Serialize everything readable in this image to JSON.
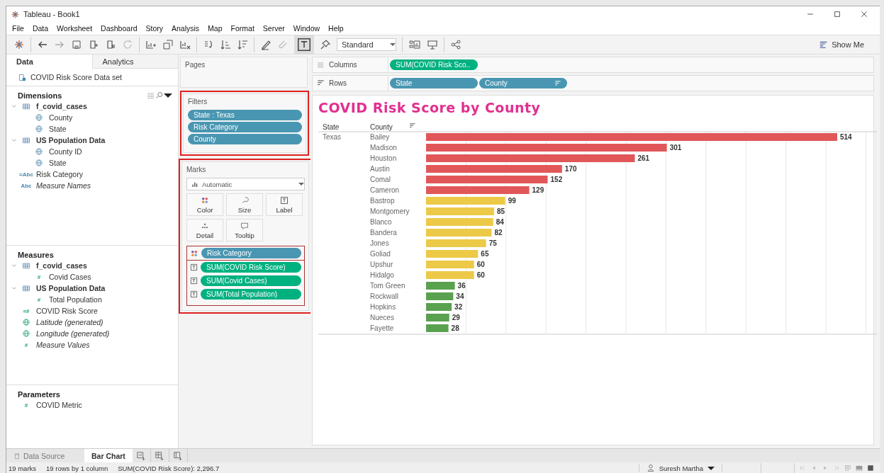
{
  "window": {
    "title": "Tableau - Book1"
  },
  "menu": [
    "File",
    "Data",
    "Worksheet",
    "Dashboard",
    "Story",
    "Analysis",
    "Map",
    "Format",
    "Server",
    "Window",
    "Help"
  ],
  "toolbar": {
    "fit_dropdown": "Standard",
    "show_me": "Show Me"
  },
  "data_pane": {
    "tabs": [
      {
        "label": "Data",
        "selected": true
      },
      {
        "label": "Analytics",
        "selected": false
      }
    ],
    "data_source": "COVID Risk Score Data set",
    "sections": [
      {
        "title": "Dimensions",
        "kind": "dimension",
        "items": [
          {
            "label": "f_covid_cases",
            "kind": "table",
            "expanded": true,
            "children": [
              {
                "label": "County",
                "kind": "geo",
                "generated": false
              },
              {
                "label": "State",
                "kind": "geo",
                "generated": false
              }
            ]
          },
          {
            "label": "US Population Data",
            "kind": "table",
            "expanded": true,
            "children": [
              {
                "label": "County ID",
                "kind": "geo",
                "generated": false
              },
              {
                "label": "State",
                "kind": "geo",
                "generated": false
              }
            ]
          },
          {
            "label": "Risk Category",
            "kind": "type",
            "icon": "=Abc",
            "generated": false
          },
          {
            "label": "Measure Names",
            "kind": "type",
            "icon": "Abc",
            "generated": true
          }
        ]
      },
      {
        "title": "Measures",
        "kind": "measure",
        "items": [
          {
            "label": "f_covid_cases",
            "kind": "table",
            "expanded": true,
            "children": [
              {
                "label": "Covid Cases",
                "kind": "type",
                "icon": "#",
                "generated": false
              }
            ]
          },
          {
            "label": "US Population Data",
            "kind": "table",
            "expanded": true,
            "children": [
              {
                "label": "Total Population",
                "kind": "type",
                "icon": "#",
                "generated": false
              }
            ]
          },
          {
            "label": "COVID Risk Score",
            "kind": "type",
            "icon": "=#",
            "generated": false
          },
          {
            "label": "Latitude (generated)",
            "kind": "geo",
            "generated": true
          },
          {
            "label": "Longitude (generated)",
            "kind": "geo",
            "generated": true
          },
          {
            "label": "Measure Values",
            "kind": "type",
            "icon": "#",
            "generated": true
          }
        ]
      },
      {
        "title": "Parameters",
        "kind": "measure",
        "items": [
          {
            "label": "COVID Metric",
            "kind": "type",
            "icon": "#",
            "generated": false
          }
        ]
      }
    ]
  },
  "pages": {
    "title": "Pages"
  },
  "filters": {
    "title": "Filters",
    "pills": [
      {
        "label": "State : Texas",
        "kind": "dimension"
      },
      {
        "label": "Risk Category",
        "kind": "dimension"
      },
      {
        "label": "County",
        "kind": "dimension"
      }
    ]
  },
  "marks": {
    "title": "Marks",
    "mark_type": "Automatic",
    "buttons": [
      {
        "label": "Color",
        "kind": "color"
      },
      {
        "label": "Size",
        "kind": "size"
      },
      {
        "label": "Label",
        "kind": "label"
      },
      {
        "label": "Detail",
        "kind": "detail"
      },
      {
        "label": "Tooltip",
        "kind": "tooltip"
      }
    ],
    "encodings": [
      {
        "kind": "color",
        "pill": {
          "label": "Risk Category",
          "kind": "dimension"
        }
      },
      {
        "kind": "label",
        "pill": {
          "label": "SUM(COVID Risk Score)",
          "kind": "measure"
        }
      },
      {
        "kind": "label",
        "pill": {
          "label": "SUM(Covid Cases)",
          "kind": "measure"
        }
      },
      {
        "kind": "label",
        "pill": {
          "label": "SUM(Total Population)",
          "kind": "measure"
        }
      }
    ]
  },
  "shelves": [
    {
      "label": "Columns",
      "kind": "columns",
      "pills": [
        {
          "label": "SUM(COVID Risk Sco..",
          "kind": "measure",
          "sorted": false
        }
      ]
    },
    {
      "label": "Rows",
      "kind": "rows",
      "pills": [
        {
          "label": "State",
          "kind": "dimension",
          "sorted": false
        },
        {
          "label": "County",
          "kind": "dimension",
          "sorted": true
        }
      ]
    }
  ],
  "view": {
    "state_header": "State",
    "state_value": "Texas",
    "chart_data": {
      "type": "bar",
      "orientation": "horizontal",
      "title": "COVID Risk Score by County",
      "ylabel": "County",
      "data_labels": true,
      "categories": [
        "Bailey",
        "Madison",
        "Houston",
        "Austin",
        "Comal",
        "Cameron",
        "Bastrop",
        "Montgomery",
        "Blanco",
        "Bandera",
        "Jones",
        "Goliad",
        "Upshur",
        "Hidalgo",
        "Tom Green",
        "Rockwall",
        "Hopkins",
        "Nueces",
        "Fayette"
      ],
      "series": [
        {
          "color": "#e15759",
          "values": [
            514,
            301,
            261,
            170,
            152,
            129,
            null,
            null,
            null,
            null,
            null,
            null,
            null,
            null,
            null,
            null,
            null,
            null,
            null
          ]
        },
        {
          "color": "#edc948",
          "values": [
            null,
            null,
            null,
            null,
            null,
            null,
            99,
            85,
            84,
            82,
            75,
            65,
            60,
            60,
            null,
            null,
            null,
            null,
            null
          ]
        },
        {
          "color": "#59a14f",
          "values": [
            null,
            null,
            null,
            null,
            null,
            null,
            null,
            null,
            null,
            null,
            null,
            null,
            null,
            null,
            36,
            34,
            32,
            29,
            28
          ]
        }
      ]
    }
  },
  "sheet_tabs": [
    {
      "label": "Data Source",
      "kind": "data_source",
      "selected": false
    },
    {
      "label": "Bar Chart",
      "kind": "sheet",
      "selected": true
    }
  ],
  "status_bar": {
    "items": [
      "19 marks",
      "19 rows by 1 column",
      "SUM(COVID Risk Score): 2,296.7"
    ],
    "user": "Suresh Martha"
  }
}
